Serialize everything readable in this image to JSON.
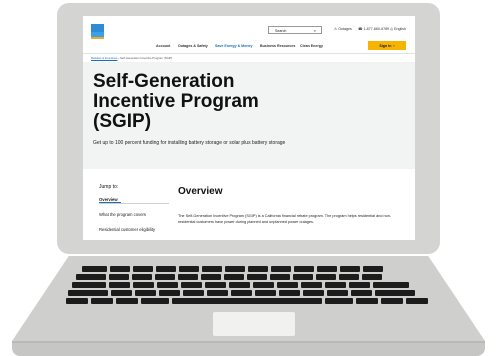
{
  "website": {
    "header": {
      "search_label": "Search",
      "outages": "Outages",
      "phone": "1-877-660-6789",
      "language": "English",
      "nav": [
        "Account",
        "Outages & Safety",
        "Save Energy & Money",
        "Business Resources",
        "Clean Energy"
      ],
      "signin": "Sign In"
    },
    "breadcrumb": {
      "parent": "Rebates & Incentives",
      "current": "Self-Generation Incentive Program (SGIP)"
    },
    "hero": {
      "title": "Self-Generation Incentive Program (SGIP)",
      "subtitle": "Get up to 100 percent funding for installing battery storage or solar plus battery storage"
    },
    "jump": {
      "label": "Jump to:",
      "items": [
        "Overview",
        "What the program covers",
        "Residential customer eligibility"
      ]
    },
    "overview": {
      "title": "Overview",
      "body": "The Self-Generation Incentive Program (SGIP) is a California financial rebate program. The program helps residential and non-residential customers have power during planned and unplanned power outages."
    }
  }
}
